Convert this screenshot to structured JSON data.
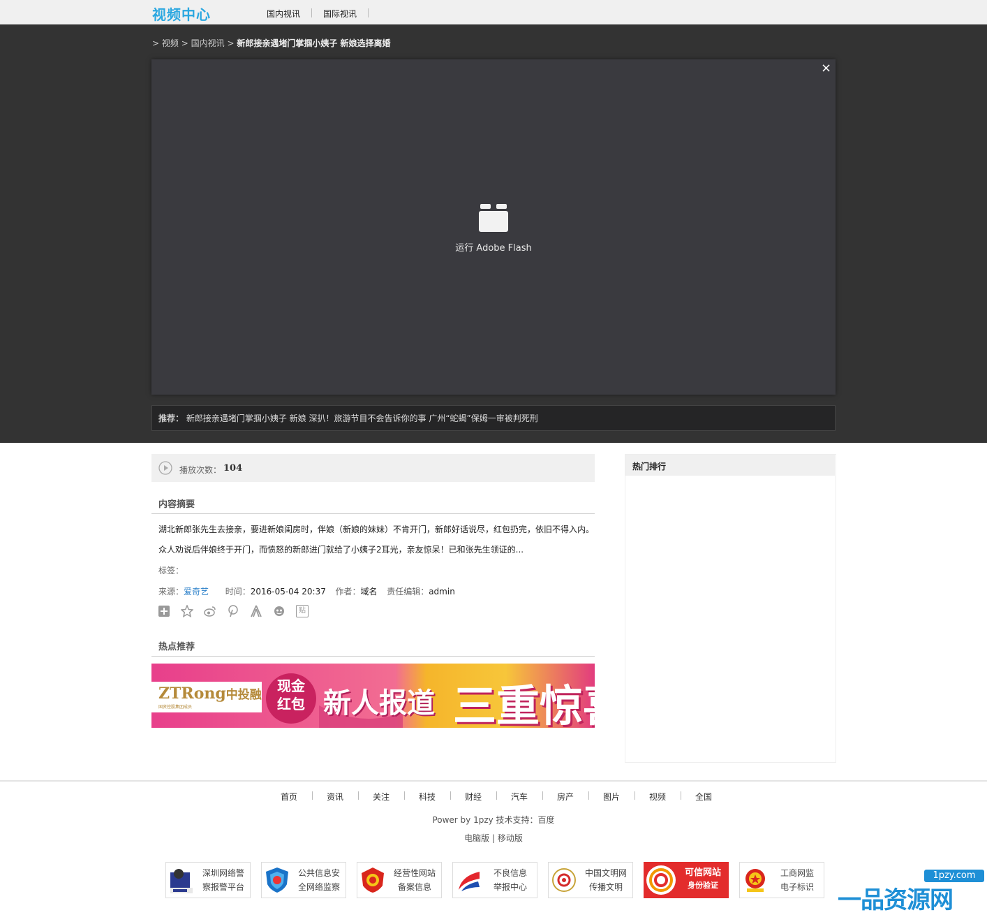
{
  "header": {
    "site_title": "视频中心",
    "nav": [
      "国内视讯",
      "国际视讯"
    ]
  },
  "breadcrumb": {
    "sep": ">",
    "items": [
      "视频",
      "国内视讯"
    ],
    "current": "新郎接亲遇堵门掌掴小姨子 新娘选择离婚"
  },
  "player": {
    "close": "×",
    "flash_label": "运行 Adobe Flash"
  },
  "recommend": {
    "label": "推荐：",
    "items": [
      "新郎接亲遇堵门掌掴小姨子 新娘",
      "深扒！旅游节目不会告诉你的事",
      "广州“蛇蝎”保姆一审被判死刑"
    ]
  },
  "stats": {
    "play_label": "播放次数：",
    "play_count": "104"
  },
  "summary": {
    "title": "内容摘要",
    "line1": "湖北新郎张先生去接亲，要进新娘闺房时，伴娘（新娘的妹妹）不肯开门，新郎好话说尽，红包扔完，依旧不得入内。",
    "line2": "众人劝说后伴娘终于开门，而愤怒的新郎进门就给了小姨子2耳光，亲友惊呆！已和张先生领证的...",
    "tags_label": "标签："
  },
  "meta": {
    "source_label": "来源：",
    "source": "爱奇艺",
    "time_label": "时间：",
    "time": "2016-05-04 20:37",
    "author_label": "作者：",
    "author": "域名",
    "editor_label": "责任编辑：",
    "editor": "admin"
  },
  "share_icons": [
    "plus-share-icon",
    "star-share-icon",
    "weibo-share-icon",
    "pinterest-share-icon",
    "renren-share-icon",
    "kaixin-share-icon",
    "tieba-share-icon"
  ],
  "share_tieba": "贴",
  "hot": {
    "title": "热点推荐"
  },
  "banner": {
    "logo": "ZTRong",
    "logo_cn": "中投融",
    "logo_sub": "国资控股集团成员",
    "bubble": [
      "现金",
      "红包"
    ],
    "headline": "新人报道",
    "headline2": "三重惊喜"
  },
  "sidebar": {
    "title": "热门排行"
  },
  "footer": {
    "links": [
      "首页",
      "资讯",
      "关注",
      "科技",
      "财经",
      "汽车",
      "房产",
      "图片",
      "视频",
      "全国"
    ],
    "powered": "Power by 1pzy  技术支持：百度",
    "pc": "电脑版",
    "sep": "|",
    "mobile": "移动版",
    "badges": [
      {
        "l1": "深圳网络警",
        "l2": "察报警平台",
        "icon": "police-icon"
      },
      {
        "l1": "公共信息安",
        "l2": "全网络监察",
        "icon": "shield-icon"
      },
      {
        "l1": "经营性网站",
        "l2": "备案信息",
        "icon": "record-icon"
      },
      {
        "l1": "不良信息",
        "l2": "举报中心",
        "icon": "report-icon"
      },
      {
        "l1": "中国文明网",
        "l2": "传播文明",
        "icon": "civilization-icon"
      },
      {
        "l1": "可信网站",
        "l2": "身份验证",
        "icon": "trusted-site-icon"
      },
      {
        "l1": "工商网监",
        "l2": "电子标识",
        "icon": "emblem-icon"
      }
    ],
    "brand_domain": "1pzy.com",
    "brand_name": "一品资源网"
  },
  "colors": {
    "accent": "#2aa7e0",
    "stage": "#333333",
    "player": "#3a3a3f",
    "link": "#2a7fc9"
  }
}
